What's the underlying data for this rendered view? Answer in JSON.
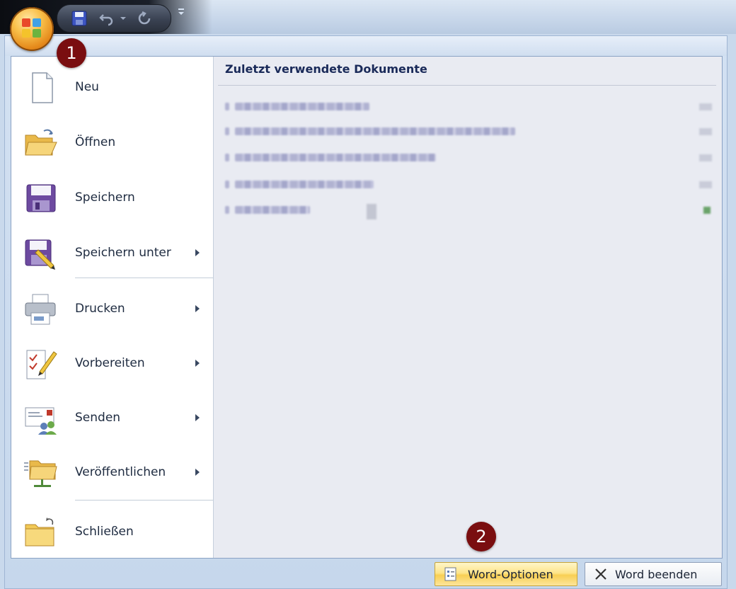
{
  "menu": {
    "items": [
      {
        "id": "neu",
        "label": "Neu",
        "has_submenu": false
      },
      {
        "id": "oeffnen",
        "label": "Öffnen",
        "has_submenu": false
      },
      {
        "id": "speichern",
        "label": "Speichern",
        "has_submenu": false
      },
      {
        "id": "speichern-unter",
        "label": "Speichern unter",
        "has_submenu": true
      },
      {
        "id": "drucken",
        "label": "Drucken",
        "has_submenu": true
      },
      {
        "id": "vorbereiten",
        "label": "Vorbereiten",
        "has_submenu": true
      },
      {
        "id": "senden",
        "label": "Senden",
        "has_submenu": true
      },
      {
        "id": "veroeffentlichen",
        "label": "Veröffentlichen",
        "has_submenu": true
      },
      {
        "id": "schliessen",
        "label": "Schließen",
        "has_submenu": false
      }
    ]
  },
  "recent": {
    "header": "Zuletzt verwendete Dokumente"
  },
  "buttons": {
    "options_label": "Word-Optionen",
    "exit_label": "Word beenden"
  },
  "badges": {
    "one": "1",
    "two": "2"
  },
  "colors": {
    "badge": "#7a0e10",
    "header_text": "#1a2a59",
    "right_pane": "#e9ebf2",
    "highlight_button": "#fde48a"
  },
  "icons": [
    "office-logo-icon",
    "save-icon",
    "undo-icon",
    "redo-icon",
    "customize-qat-icon",
    "new-document-icon",
    "open-folder-icon",
    "save-icon",
    "save-as-icon",
    "print-icon",
    "prepare-icon",
    "send-icon",
    "publish-icon",
    "close-folder-icon",
    "options-icon",
    "close-icon"
  ]
}
